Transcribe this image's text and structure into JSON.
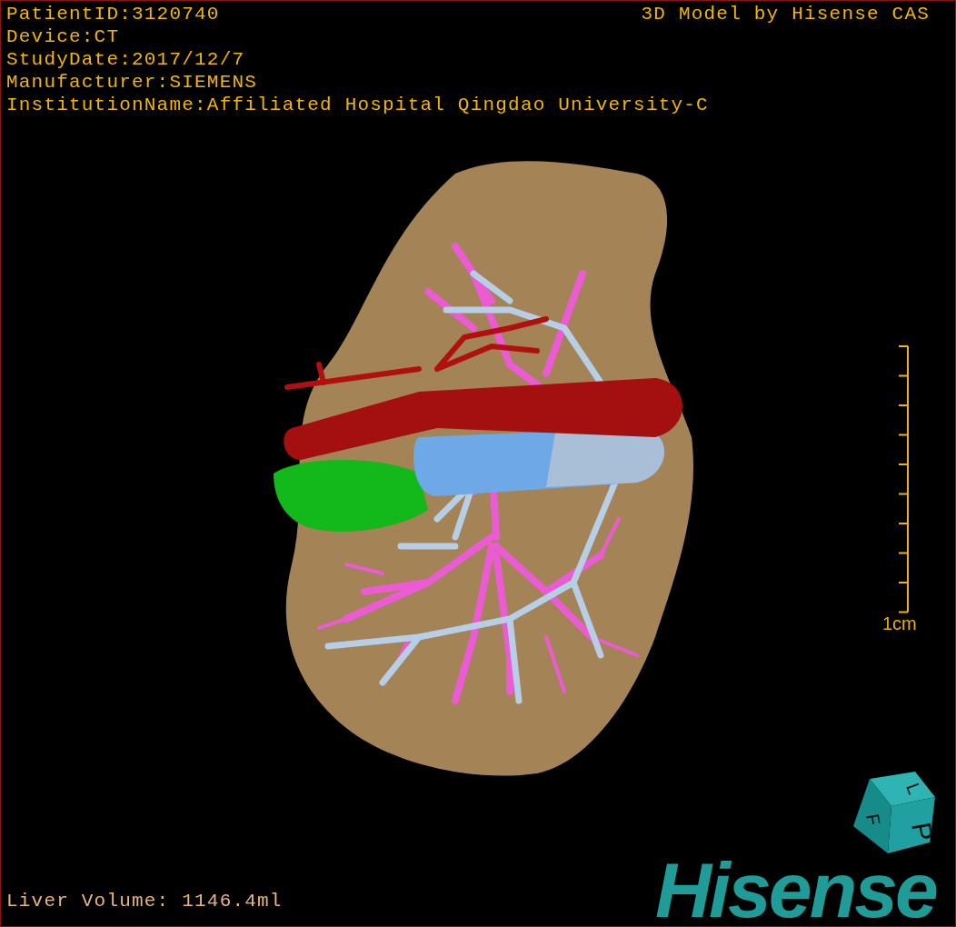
{
  "patient_info": [
    "PatientID:3120740",
    "Device:CT",
    "StudyDate:2017/12/7",
    "Manufacturer:SIEMENS",
    "InstitutionName:Affiliated Hospital Qingdao University-C"
  ],
  "title": "3D Model by Hisense CAS",
  "scale_bar": {
    "label": "1cm"
  },
  "liver_volume": "Liver Volume: 1146.4ml",
  "orientation_cube": {
    "faces": [
      "L",
      "P",
      "F"
    ]
  },
  "logo": "Hisense"
}
